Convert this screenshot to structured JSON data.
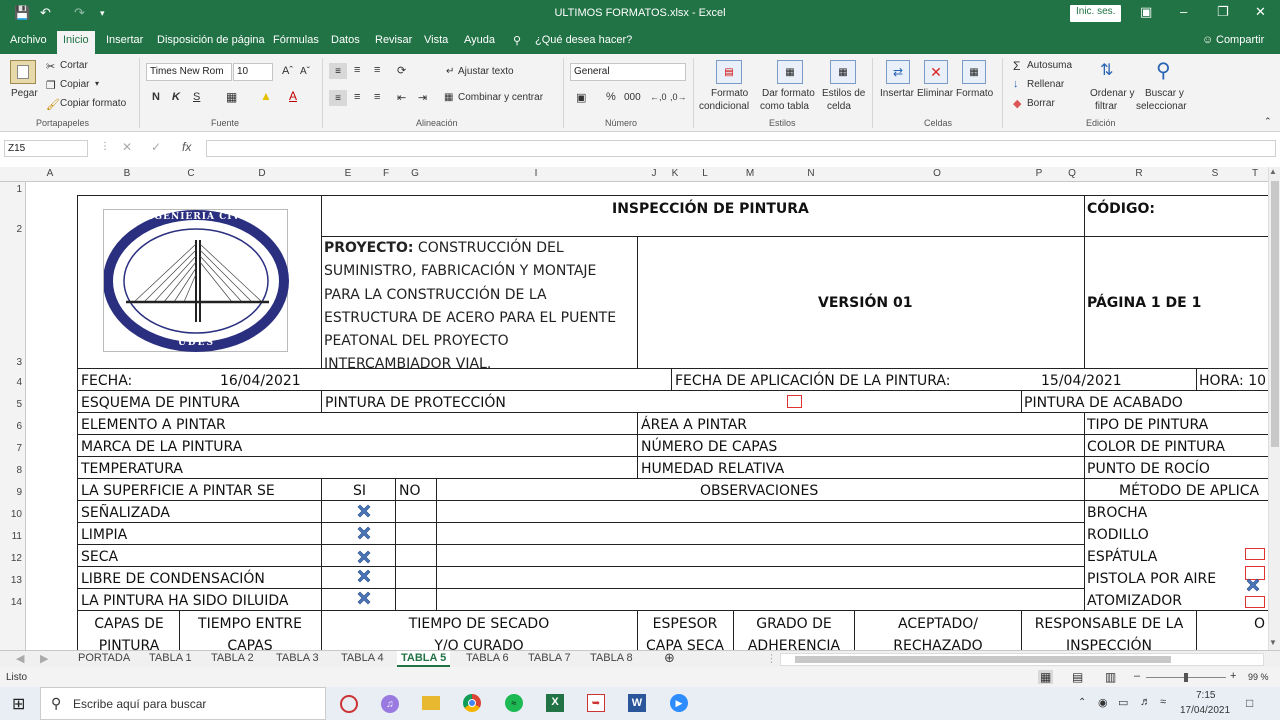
{
  "window": {
    "title": "ULTIMOS FORMATOS.xlsx  -  Excel",
    "signin": "Inic. ses."
  },
  "menu": {
    "tabs": [
      "Archivo",
      "Inicio",
      "Insertar",
      "Disposición de página",
      "Fórmulas",
      "Datos",
      "Revisar",
      "Vista",
      "Ayuda"
    ],
    "tell_me": "¿Qué desea hacer?",
    "share": "Compartir"
  },
  "ribbon": {
    "paste": "Pegar",
    "cut": "Cortar",
    "copy": "Copiar",
    "copy_format": "Copiar formato",
    "font_name": "Times New Rom",
    "font_size": "10",
    "wrap": "Ajustar texto",
    "merge": "Combinar y centrar",
    "number_format": "General",
    "cond_format_1": "Formato",
    "cond_format_2": "condicional",
    "table_format_1": "Dar formato",
    "table_format_2": "como tabla",
    "cell_styles_1": "Estilos de",
    "cell_styles_2": "celda",
    "insert": "Insertar",
    "delete": "Eliminar",
    "format": "Formato",
    "autosum": "Autosuma",
    "fill": "Rellenar",
    "clear": "Borrar",
    "sort_1": "Ordenar y",
    "sort_2": "filtrar",
    "find_1": "Buscar y",
    "find_2": "seleccionar",
    "groups": [
      "Portapapeles",
      "Fuente",
      "Alineación",
      "Número",
      "Estilos",
      "Celdas",
      "Edición"
    ],
    "bold": "N",
    "italic": "K",
    "underline": "S"
  },
  "formula_bar": {
    "name_box": "Z15",
    "fx": "fx"
  },
  "columns": [
    "A",
    "B",
    "C",
    "D",
    "E",
    "F",
    "G",
    "I",
    "J",
    "K",
    "L",
    "M",
    "N",
    "O",
    "P",
    "Q",
    "R",
    "S",
    "T"
  ],
  "rows": [
    "1",
    "2",
    "3",
    "4",
    "5",
    "6",
    "7",
    "8",
    "9",
    "10",
    "11",
    "12",
    "13",
    "14"
  ],
  "sheet": {
    "logo_top": "INGENIERIA CIVIL",
    "logo_bottom": "UDES",
    "title": "INSPECCIÓN DE PINTURA",
    "code": "CÓDIGO:",
    "project_label": "PROYECTO:",
    "project_lines": [
      " CONSTRUCCIÓN DEL",
      "SUMINISTRO, FABRICACIÓN Y MONTAJE",
      "PARA LA CONSTRUCCIÓN DE LA",
      "ESTRUCTURA DE ACERO PARA EL PUENTE",
      "PEATONAL DEL PROYECTO",
      "INTERCAMBIADOR VIAL."
    ],
    "version": "VERSIÓN 01",
    "page": "PÁGINA 1 DE 1",
    "fecha_label": "FECHA:",
    "fecha": "16/04/2021",
    "fecha_app_label": "FECHA DE APLICACIÓN DE LA PINTURA:",
    "fecha_app": "15/04/2021",
    "hora": "HORA: 10",
    "esquema": "ESQUEMA DE PINTURA",
    "proteccion": "PINTURA DE PROTECCIÓN",
    "acabado": "PINTURA DE ACABADO",
    "elemento": "ELEMENTO A PINTAR",
    "area": "ÁREA A PINTAR",
    "tipo": "TIPO DE PINTURA",
    "marca": "MARCA DE LA PINTURA",
    "capas": "NÚMERO DE CAPAS",
    "color": "COLOR DE PINTURA",
    "temperatura": "TEMPERATURA",
    "humedad": "HUMEDAD RELATIVA",
    "rocio": "PUNTO DE ROCÍO",
    "superficie": "LA SUPERFICIE A PINTAR SE",
    "si": "SI",
    "no": "NO",
    "obs": "OBSERVACIONES",
    "metodo": "MÉTODO DE APLICA",
    "conditions": [
      "SEÑALIZADA",
      "LIMPIA",
      "SECA",
      "LIBRE DE CONDENSACIÓN",
      "LA PINTURA HA SIDO DILUIDA"
    ],
    "methods": [
      "BROCHA",
      "RODILLO",
      "ESPÁTULA",
      "PISTOLA POR AIRE",
      "ATOMIZADOR"
    ],
    "footer_headers": [
      [
        "CAPAS DE",
        "PINTURA"
      ],
      [
        "TIEMPO ENTRE",
        "CAPAS"
      ],
      [
        "TIEMPO DE SECADO",
        "Y/O CURADO"
      ],
      [
        "ESPESOR",
        "CAPA SECA"
      ],
      [
        "GRADO DE",
        "ADHERENCIA"
      ],
      [
        "ACEPTADO/",
        "RECHAZADO"
      ],
      [
        "RESPONSABLE DE LA",
        "INSPECCIÓN"
      ],
      [
        "O",
        ""
      ]
    ]
  },
  "sheet_tabs": [
    "PORTADA",
    "TABLA 1",
    "TABLA 2",
    "TABLA 3",
    "TABLA 4",
    "TABLA 5",
    "TABLA 6",
    "TABLA 7",
    "TABLA 8"
  ],
  "active_sheet": "TABLA 5",
  "status": {
    "ready": "Listo",
    "zoom": "99 %"
  },
  "taskbar": {
    "search": "Escribe aquí para buscar",
    "time": "7:15",
    "date": "17/04/2021"
  },
  "colors": {
    "excel_green": "#217346",
    "x_blue": "#4a76b8",
    "logo_navy": "#2a2f80"
  }
}
